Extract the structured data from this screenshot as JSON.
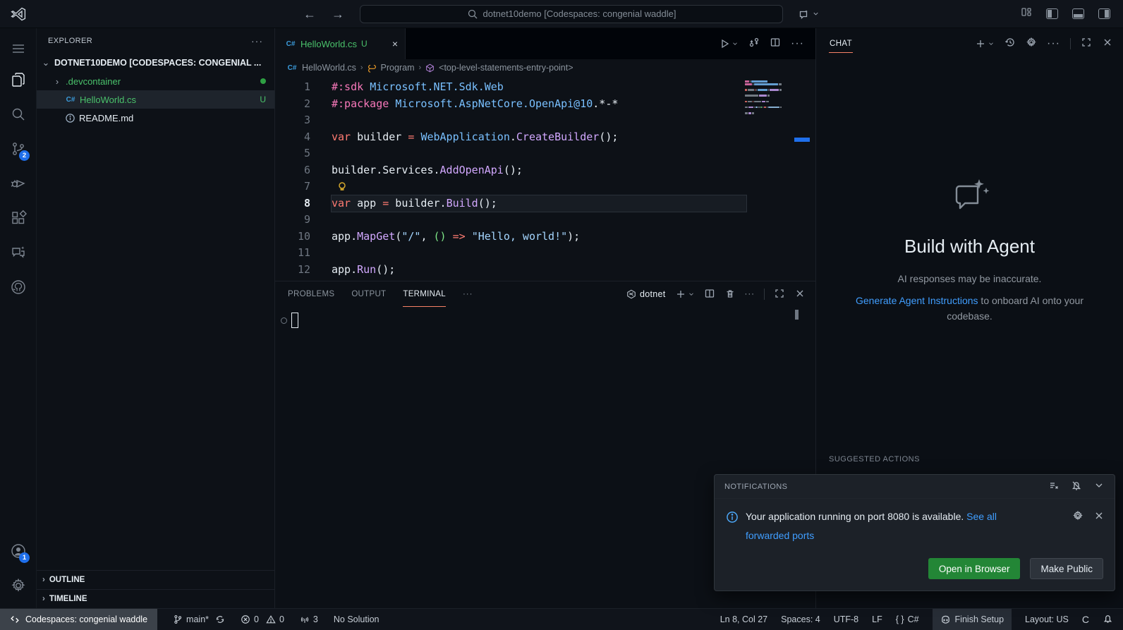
{
  "titlebar": {
    "search_text": "dotnet10demo [Codespaces: congenial waddle]"
  },
  "activity_bar": {
    "scm_badge": "2",
    "account_badge": "1"
  },
  "sidebar": {
    "title": "EXPLORER",
    "more_label": "···",
    "root_label": "DOTNET10DEMO [CODESPACES: CONGENIAL ...",
    "items": [
      {
        "label": ".devcontainer"
      },
      {
        "label": "HelloWorld.cs",
        "badge": "U",
        "icon": "C#"
      },
      {
        "label": "README.md"
      }
    ],
    "outline_label": "OUTLINE",
    "timeline_label": "TIMELINE"
  },
  "editor": {
    "tab": {
      "label": "HelloWorld.cs",
      "badge": "U",
      "close": "×"
    },
    "breadcrumbs": [
      "HelloWorld.cs",
      "Program",
      "<top-level-statements-entry-point>"
    ],
    "code_lines": [
      {
        "n": "1",
        "tokens": [
          {
            "t": "#:sdk",
            "c": "d"
          },
          {
            "t": " ",
            "c": "p"
          },
          {
            "t": "Microsoft.NET.Sdk.Web",
            "c": "e"
          }
        ]
      },
      {
        "n": "2",
        "tokens": [
          {
            "t": "#:package",
            "c": "d"
          },
          {
            "t": " ",
            "c": "p"
          },
          {
            "t": "Microsoft.AspNetCore.OpenApi@10",
            "c": "e"
          },
          {
            "t": ".*-*",
            "c": "p"
          }
        ]
      },
      {
        "n": "3",
        "tokens": []
      },
      {
        "n": "4",
        "tokens": [
          {
            "t": "var",
            "c": "k"
          },
          {
            "t": " builder ",
            "c": "p"
          },
          {
            "t": "=",
            "c": "k"
          },
          {
            "t": " ",
            "c": "p"
          },
          {
            "t": "WebApplication",
            "c": "e"
          },
          {
            "t": ".",
            "c": "p"
          },
          {
            "t": "CreateBuilder",
            "c": "f"
          },
          {
            "t": "();",
            "c": "p"
          }
        ]
      },
      {
        "n": "5",
        "tokens": []
      },
      {
        "n": "6",
        "tokens": [
          {
            "t": "builder.Services.",
            "c": "p"
          },
          {
            "t": "AddOpenApi",
            "c": "f"
          },
          {
            "t": "();",
            "c": "p"
          }
        ]
      },
      {
        "n": "7",
        "tokens": [],
        "lightbulb": true
      },
      {
        "n": "8",
        "current": true,
        "tokens": [
          {
            "t": "var",
            "c": "k"
          },
          {
            "t": " app ",
            "c": "p"
          },
          {
            "t": "=",
            "c": "k"
          },
          {
            "t": " builder.",
            "c": "p"
          },
          {
            "t": "Build",
            "c": "f"
          },
          {
            "t": "();",
            "c": "p"
          }
        ]
      },
      {
        "n": "9",
        "tokens": []
      },
      {
        "n": "10",
        "tokens": [
          {
            "t": "app.",
            "c": "p"
          },
          {
            "t": "MapGet",
            "c": "f"
          },
          {
            "t": "(",
            "c": "p"
          },
          {
            "t": "\"/\"",
            "c": "s"
          },
          {
            "t": ", ",
            "c": "p"
          },
          {
            "t": "()",
            "c": "g"
          },
          {
            "t": " ",
            "c": "p"
          },
          {
            "t": "=>",
            "c": "k"
          },
          {
            "t": " ",
            "c": "p"
          },
          {
            "t": "\"Hello, world!\"",
            "c": "s"
          },
          {
            "t": ");",
            "c": "p"
          }
        ]
      },
      {
        "n": "11",
        "tokens": []
      },
      {
        "n": "12",
        "tokens": [
          {
            "t": "app.",
            "c": "p"
          },
          {
            "t": "Run",
            "c": "f"
          },
          {
            "t": "();",
            "c": "p"
          }
        ]
      }
    ]
  },
  "panel": {
    "tabs": [
      {
        "label": "PROBLEMS"
      },
      {
        "label": "OUTPUT"
      },
      {
        "label": "TERMINAL"
      }
    ],
    "more_label": "···",
    "terminal_label": "dotnet"
  },
  "chat": {
    "title": "CHAT",
    "more_label": "···",
    "empty_title": "Build with Agent",
    "disclaimer": "AI responses may be inaccurate.",
    "link_text": "Generate Agent Instructions",
    "link_suffix": " to onboard AI onto your codebase.",
    "suggested_header": "SUGGESTED ACTIONS"
  },
  "notifications": {
    "header": "NOTIFICATIONS",
    "message": "Your application running on port 8080 is available. ",
    "link_text": "See all forwarded ports",
    "open_button": "Open in Browser",
    "public_button": "Make Public"
  },
  "status_bar": {
    "remote": "Codespaces: congenial waddle",
    "branch": "main*",
    "errors": "0",
    "warnings": "0",
    "ports": "3",
    "solution": "No Solution",
    "cursor": "Ln 8, Col 27",
    "indent": "Spaces: 4",
    "encoding": "UTF-8",
    "eol": "LF",
    "braces": "{ }",
    "language": "C#",
    "copilot": "Finish Setup",
    "layout": "Layout: US",
    "c_item": "C"
  },
  "colors": {
    "accent_orange": "#f78166",
    "green_file": "#4ac26b",
    "badge_blue": "#1f6feb",
    "button_green": "#238636",
    "link_blue": "#409eff"
  }
}
